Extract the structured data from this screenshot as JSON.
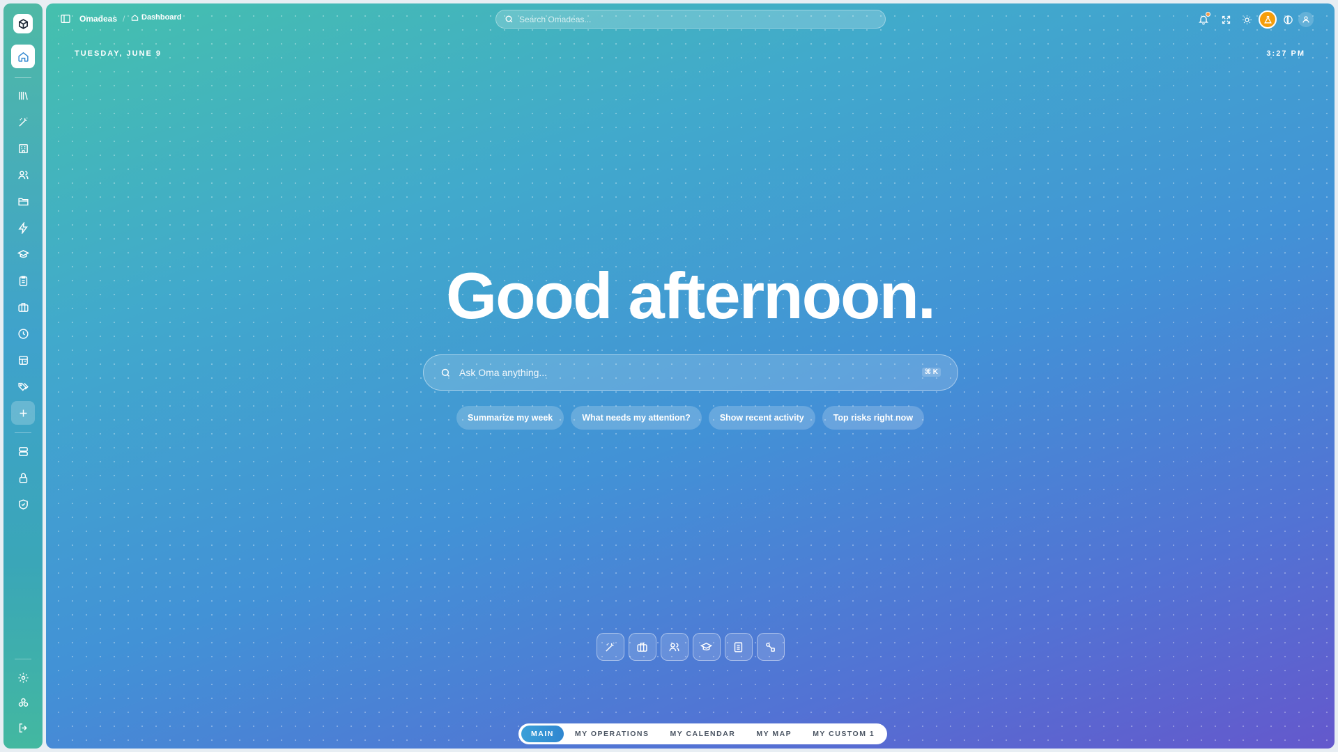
{
  "header": {
    "brand": "Omadeas",
    "breadcrumb": "Dashboard",
    "search_placeholder": "Search Omadeas..."
  },
  "sidebar": {
    "items": [
      {
        "icon": "home-icon"
      },
      {
        "icon": "library-icon"
      },
      {
        "icon": "magic-wand-icon"
      },
      {
        "icon": "building-icon"
      },
      {
        "icon": "users-icon"
      },
      {
        "icon": "folder-icon"
      },
      {
        "icon": "lightning-icon"
      },
      {
        "icon": "graduation-cap-icon"
      },
      {
        "icon": "clipboard-icon"
      },
      {
        "icon": "briefcase-icon"
      },
      {
        "icon": "clock-icon"
      },
      {
        "icon": "store-icon"
      },
      {
        "icon": "tags-icon"
      },
      {
        "icon": "plus-icon"
      },
      {
        "icon": "database-icon"
      },
      {
        "icon": "lock-icon"
      },
      {
        "icon": "shield-icon"
      },
      {
        "icon": "settings-icon"
      },
      {
        "icon": "integrations-icon"
      },
      {
        "icon": "logout-icon"
      }
    ]
  },
  "datetime": {
    "date": "TUESDAY, JUNE 9",
    "time": "3:27 PM"
  },
  "greeting": "Good afternoon.",
  "ask": {
    "placeholder": "Ask Oma anything...",
    "shortcut": "⌘ K"
  },
  "suggestions": [
    "Summarize my week",
    "What needs my attention?",
    "Show recent activity",
    "Top risks right now"
  ],
  "quick_actions": [
    {
      "icon": "magic-wand-icon"
    },
    {
      "icon": "briefcase-icon"
    },
    {
      "icon": "users-icon"
    },
    {
      "icon": "graduation-cap-icon"
    },
    {
      "icon": "document-icon"
    },
    {
      "icon": "workflow-icon"
    }
  ],
  "tabs": [
    {
      "label": "MAIN",
      "active": true
    },
    {
      "label": "MY OPERATIONS",
      "active": false
    },
    {
      "label": "MY CALENDAR",
      "active": false
    },
    {
      "label": "MY MAP",
      "active": false
    },
    {
      "label": "MY CUSTOM 1",
      "active": false
    }
  ],
  "colors": {
    "accent": "#2f86d0",
    "notification": "#f2994a",
    "avatar": "#f59e0b"
  }
}
